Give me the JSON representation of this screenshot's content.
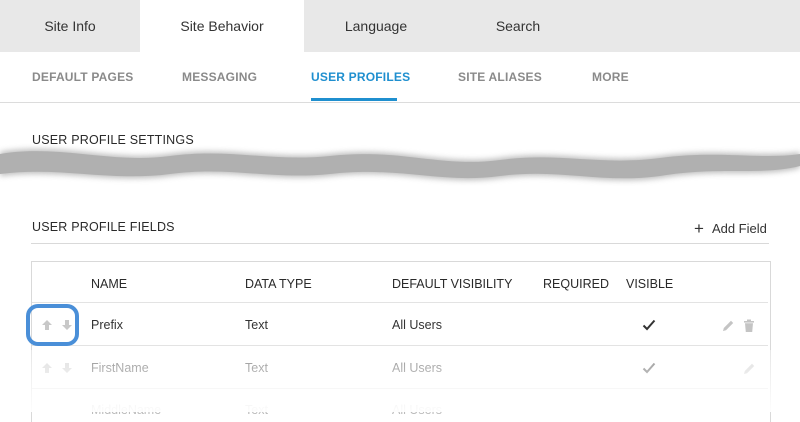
{
  "top_tabs": [
    "Site Info",
    "Site Behavior",
    "Language",
    "Search"
  ],
  "sub_tabs": [
    "DEFAULT PAGES",
    "MESSAGING",
    "USER PROFILES",
    "SITE ALIASES",
    "MORE"
  ],
  "settings_title": "USER PROFILE SETTINGS",
  "fields_title": "USER PROFILE FIELDS",
  "add_field_label": "Add Field",
  "columns": [
    "NAME",
    "DATA TYPE",
    "DEFAULT VISIBILITY",
    "REQUIRED",
    "VISIBLE"
  ],
  "rows": [
    {
      "name": "Prefix",
      "data_type": "Text",
      "visibility": "All Users",
      "required": false,
      "visible": true
    },
    {
      "name": "FirstName",
      "data_type": "Text",
      "visibility": "All Users",
      "required": false,
      "visible": true
    },
    {
      "name": "MiddleName",
      "data_type": "Text",
      "visibility": "All Users",
      "required": false,
      "visible": true
    }
  ],
  "colors": {
    "accent": "#1f8fcf",
    "highlight": "#4a8fd8",
    "tab_bg": "#e8e8e8"
  }
}
